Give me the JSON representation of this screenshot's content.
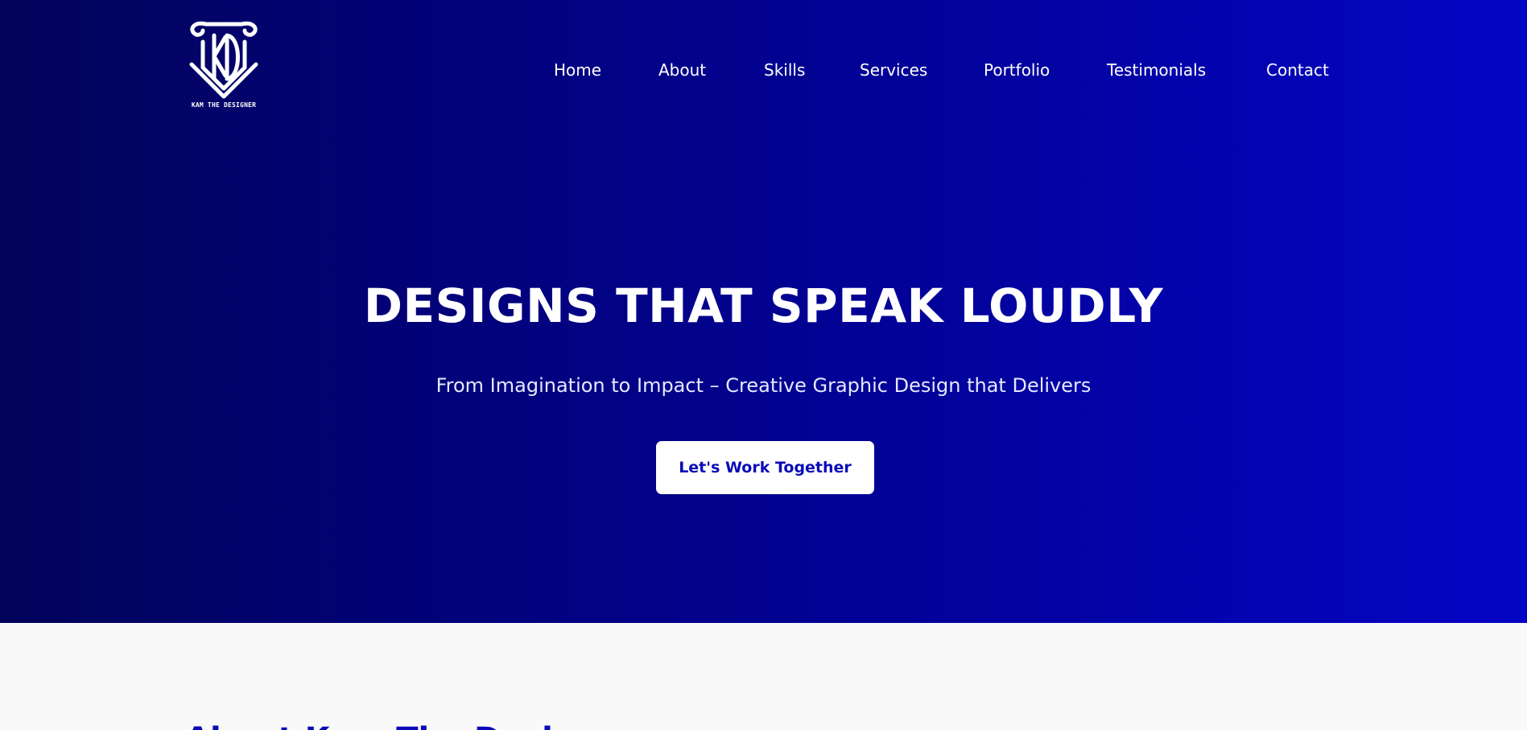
{
  "brand": {
    "logo_icon": "kd-monogram-logo",
    "logo_caption": "KAM THE DESIGNER"
  },
  "nav": {
    "items": [
      {
        "label": "Home"
      },
      {
        "label": "About"
      },
      {
        "label": "Skills"
      },
      {
        "label": "Services"
      },
      {
        "label": "Portfolio"
      },
      {
        "label": "Testimonials"
      },
      {
        "label": "Contact"
      }
    ]
  },
  "hero": {
    "title": "DESIGNS THAT SPEAK LOUDLY",
    "subtitle": "From Imagination to Impact – Creative Graphic Design that Delivers",
    "cta_label": "Let's Work Together"
  },
  "about": {
    "heading": "About Kam The Designer"
  },
  "colors": {
    "hero_gradient_start": "#03035a",
    "hero_gradient_end": "#0404c4",
    "accent": "#0a0ab8",
    "text_on_dark": "#ffffff",
    "section_bg": "#f9f9f9"
  }
}
